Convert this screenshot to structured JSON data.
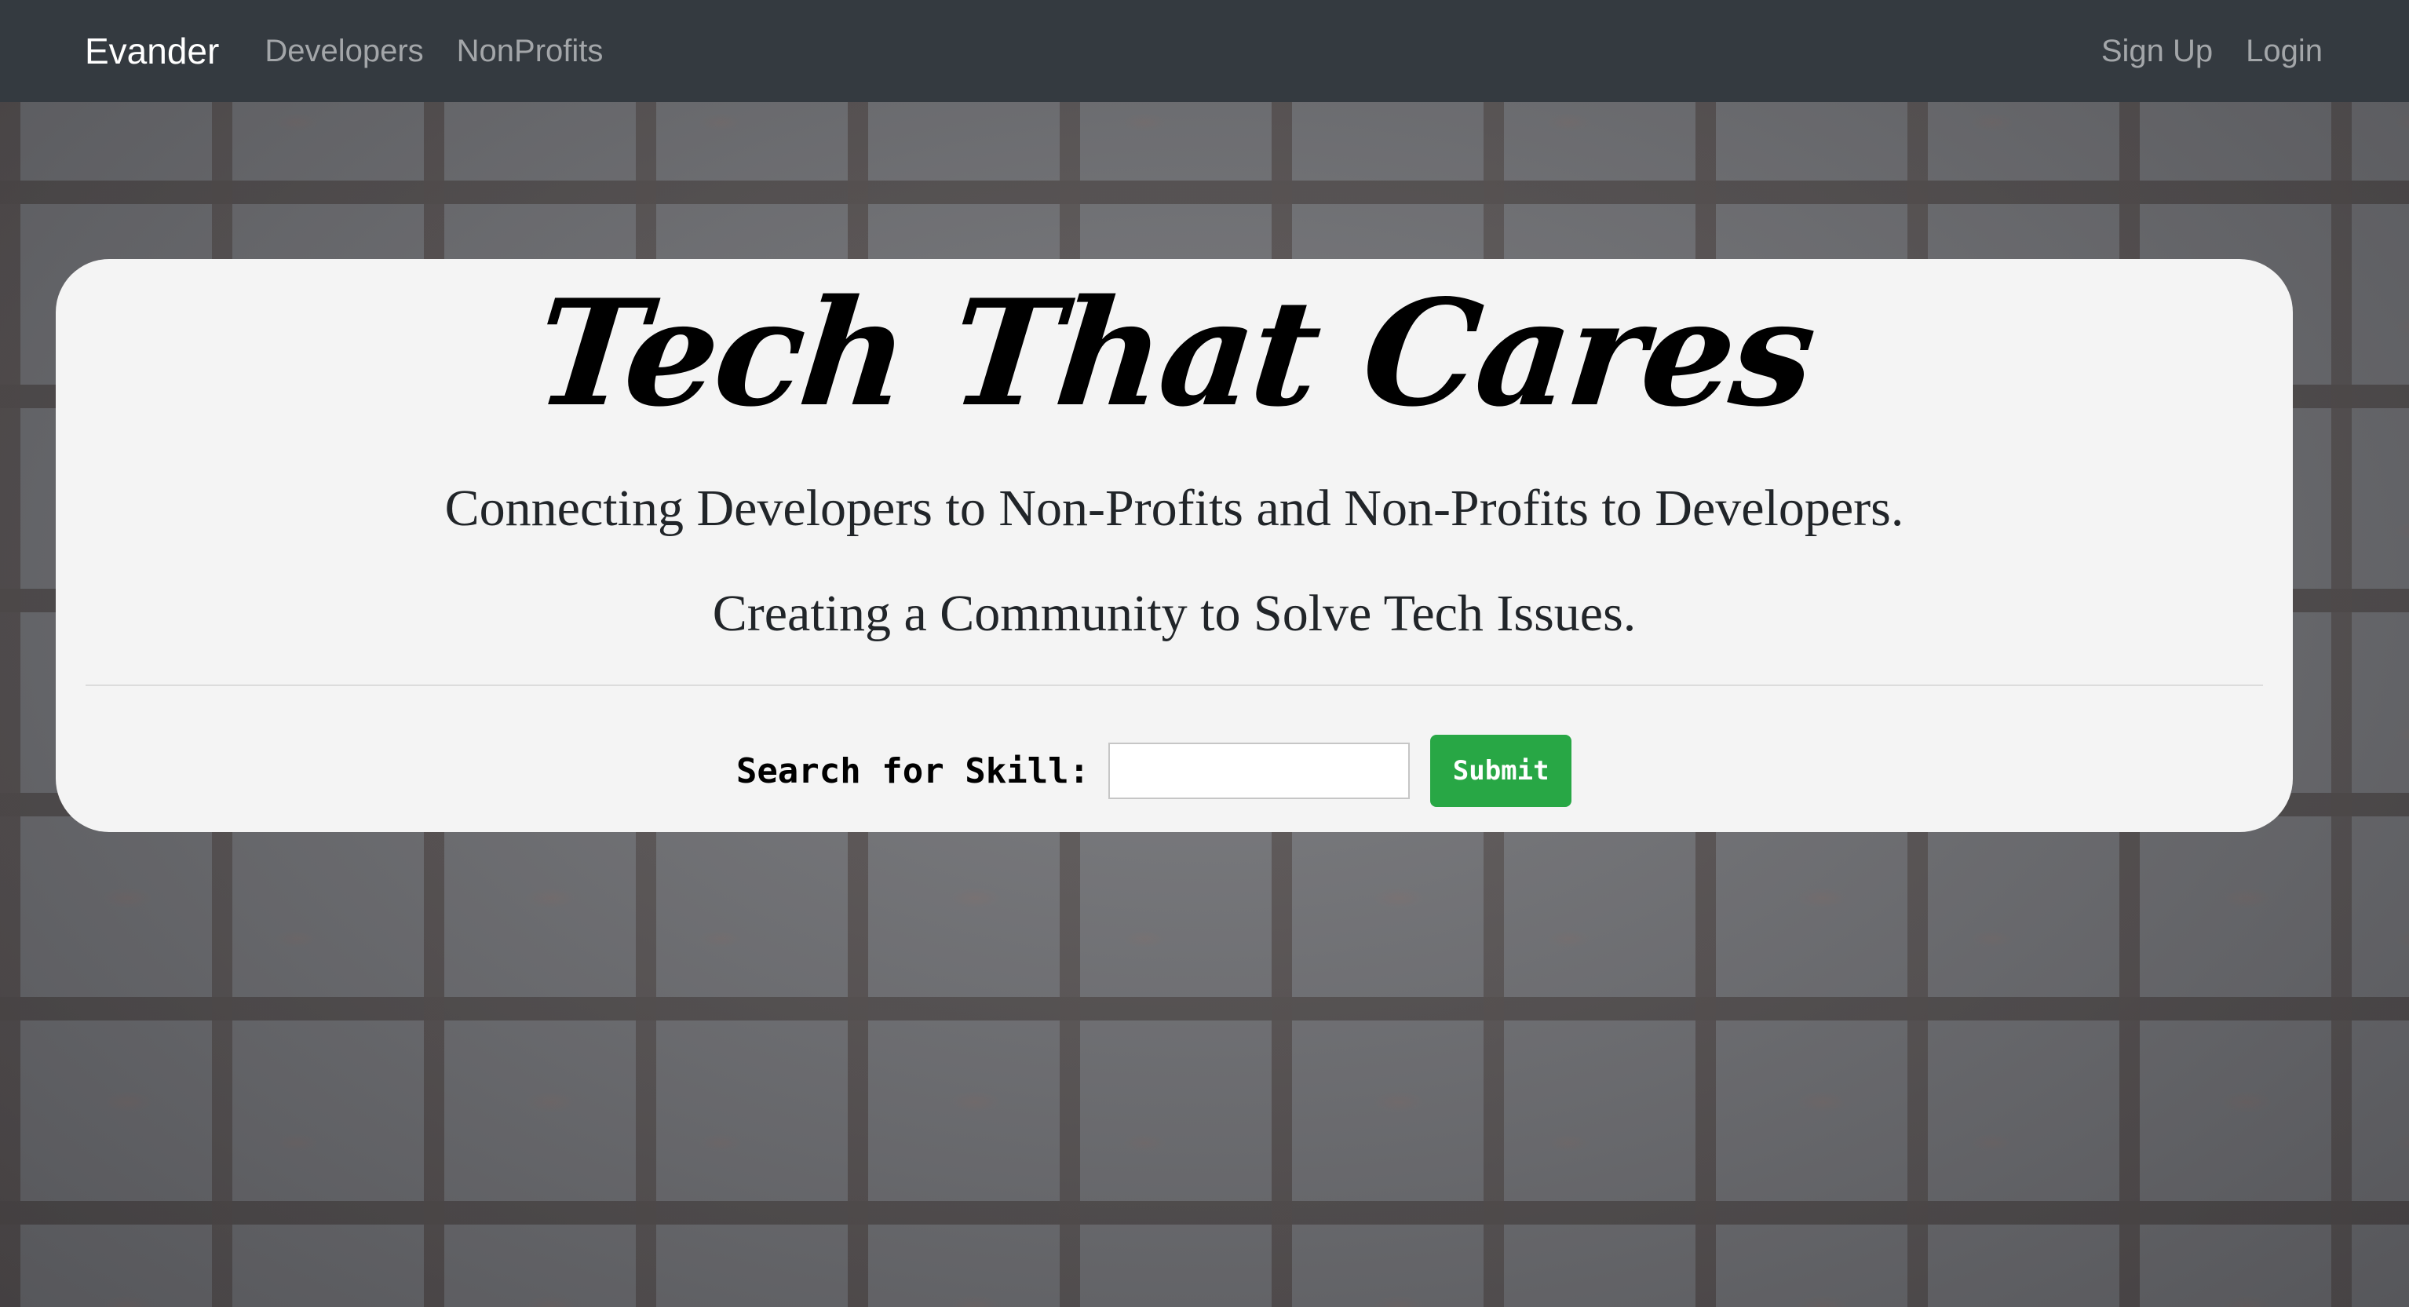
{
  "navbar": {
    "brand": "Evander",
    "links": [
      "Developers",
      "NonProfits"
    ],
    "right_links": [
      "Sign Up",
      "Login"
    ],
    "background_color": "#343a40"
  },
  "hero": {
    "title": "Tech That Cares",
    "tagline_1": "Connecting Developers to Non-Profits and Non-Profits to Developers.",
    "tagline_2": "Creating a Community to Solve Tech Issues."
  },
  "search": {
    "label": "Search for Skill:",
    "input_value": "",
    "submit_label": "Submit",
    "submit_color": "#28a745"
  },
  "background": {
    "description_icon": "brick-wall-background"
  }
}
